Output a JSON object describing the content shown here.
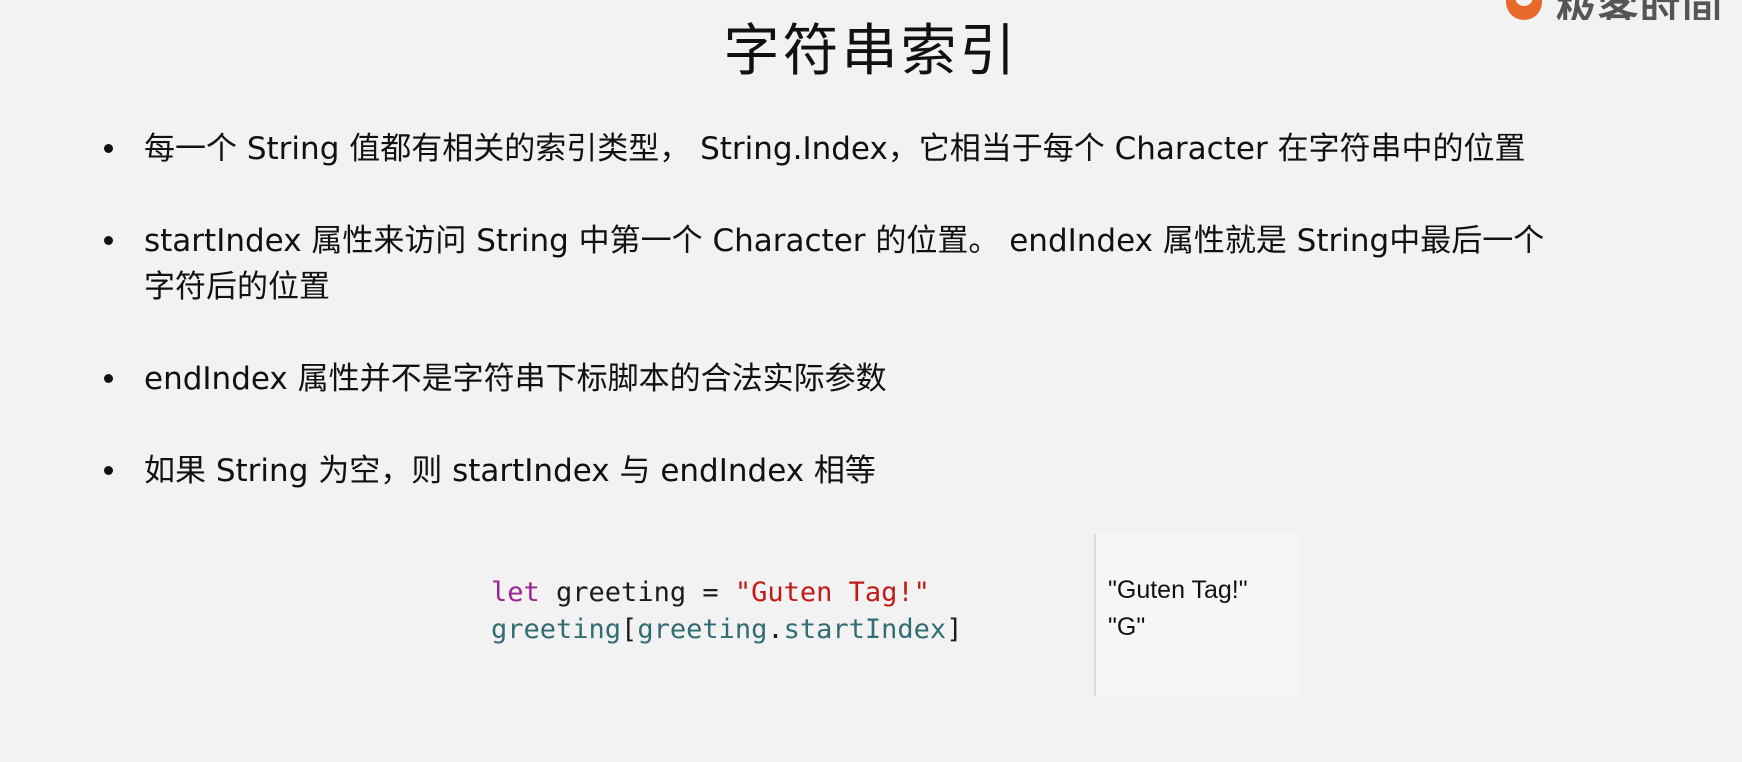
{
  "logo": {
    "text": "极客时间"
  },
  "title": "字符串索引",
  "bullets": [
    "每一个 String 值都有相关的索引类型， String.Index，它相当于每个 Character 在字符串中的位置",
    "startIndex 属性来访问 String 中第一个 Character 的位置。 endIndex 属性就是 String中最后一个字符后的位置",
    "endIndex 属性并不是字符串下标脚本的合法实际参数",
    "如果 String 为空，则 startIndex 与 endIndex 相等"
  ],
  "code": {
    "line1": {
      "keyword": "let",
      "name": " greeting = ",
      "string": "\"Guten Tag!\""
    },
    "line2": {
      "a": "greeting",
      "b": "[",
      "c": "greeting",
      "d": ".",
      "e": "startIndex",
      "f": "]"
    }
  },
  "results": [
    "\"Guten Tag!\"",
    "\"G\""
  ],
  "colors": {
    "keyword": "#9b2393",
    "string": "#c41a16",
    "identifier": "#326d74",
    "logo_accent": "#e8692a"
  }
}
